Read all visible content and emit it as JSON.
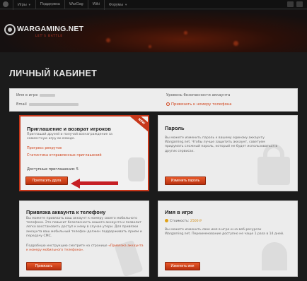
{
  "topnav": {
    "items": [
      "Игры",
      "Поддержка",
      "WarGag",
      "Wiki",
      "Форумы"
    ]
  },
  "banner": {
    "brand": "WARGAMING.NET",
    "tagline": "LET'S BATTLE"
  },
  "page": {
    "title": "ЛИЧНЫЙ КАБИНЕТ"
  },
  "account": {
    "name_label": "Имя в игре",
    "email_label": "Email",
    "security_label": "Уровень безопасности аккаунта",
    "bind_phone_link": "Привязать к номеру телефона"
  },
  "invite_card": {
    "title": "Приглашение и возврат игроков",
    "badge": "NEW",
    "description": "Приглашай друзей и получай вознаграждение за совместную игру во взводе.",
    "link_progress": "Прогресс рекрутов",
    "link_stats": "Статистика отправленных приглашений",
    "available_label": "Доступные приглашения: 5",
    "button": "Пригласить друга"
  },
  "password_card": {
    "title": "Пароль",
    "description": "Вы можете изменить пароль к вашему единому аккаунту Wargaming.net. Чтобы лучше защитить аккаунт, советуем придумать сложный пароль, который не будет использоваться в других сервисах.",
    "button": "Изменить пароль"
  },
  "phone_card": {
    "title": "Привязка аккаунта к телефону",
    "description": "Вы можете привязать ваш аккаунт к номеру своего мобильного телефона. Это повысит безопасность вашего аккаунта и позволит легко восстановить доступ к нему в случае утери. Для привязки аккаунта ваш мобильный телефон должен поддерживать прием и передачу СМС.",
    "instruction_prefix": "Подробную инструкцию смотрите на странице",
    "instruction_link": "«Привязка аккаунта к номеру мобильного телефона».",
    "button": "Привязать"
  },
  "name_card": {
    "title": "Имя в игре",
    "cost_label": "Стоимость:",
    "cost_value": "2500 ₽",
    "description": "Вы можете изменить свое имя в игре и на веб-ресурсах Wargaming.net. Переименование доступно не чаще 1 раза в 14 дней.",
    "button": "Изменить имя"
  },
  "colors": {
    "accent": "#d1451d",
    "highlight_border": "#c7371a",
    "arrow": "#c61f24"
  }
}
